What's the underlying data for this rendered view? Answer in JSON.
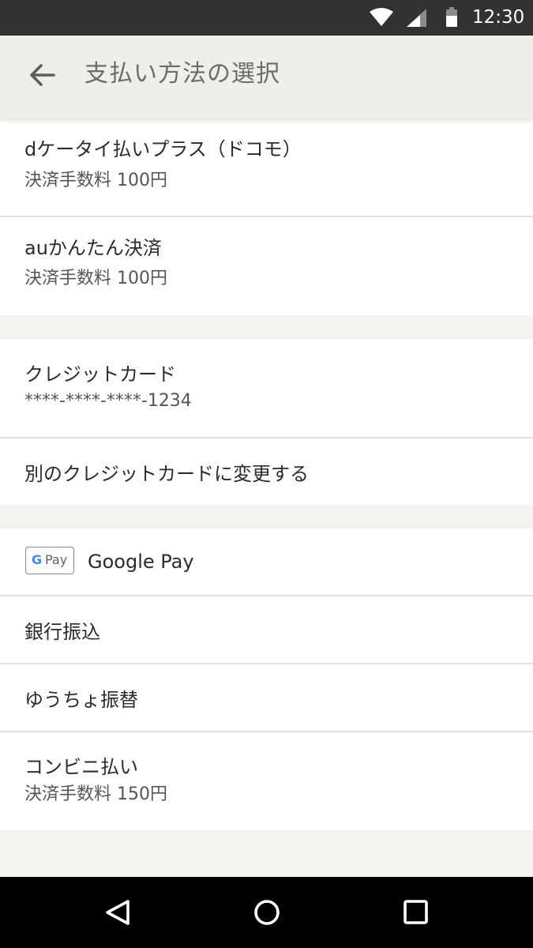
{
  "status_bar": {
    "time": "12:30",
    "icons": [
      "wifi-icon",
      "cell-signal-icon",
      "battery-icon"
    ]
  },
  "app_bar": {
    "back_icon": "arrow-left-icon",
    "title": "支払い方法の選択"
  },
  "payment_methods": {
    "carrier": [
      {
        "label": "dケータイ払いプラス（ドコモ）",
        "sub": "決済手数料 100円"
      },
      {
        "label": "auかんたん決済",
        "sub": "決済手数料 100円"
      }
    ],
    "card": {
      "label": "クレジットカード",
      "number": "****-****-****-1234",
      "change_label": "別のクレジットカードに変更する"
    },
    "other": {
      "google_pay": {
        "badge_g": "G",
        "badge_pay": "Pay",
        "label": "Google Pay"
      },
      "bank_transfer": "銀行振込",
      "postal_transfer": "ゆうちょ振替",
      "convenience": {
        "label": "コンビニ払い",
        "sub": "決済手数料 150円"
      }
    }
  },
  "nav_bar": {
    "icons": [
      "back-triangle-icon",
      "home-circle-icon",
      "recents-square-icon"
    ]
  },
  "colors": {
    "status_bar_bg": "#333230",
    "app_bar_bg": "#efeee8",
    "page_bg": "#f4f3ee",
    "item_bg": "#ffffff",
    "divider": "#e3e2db",
    "title_text": "#6e6c67"
  }
}
